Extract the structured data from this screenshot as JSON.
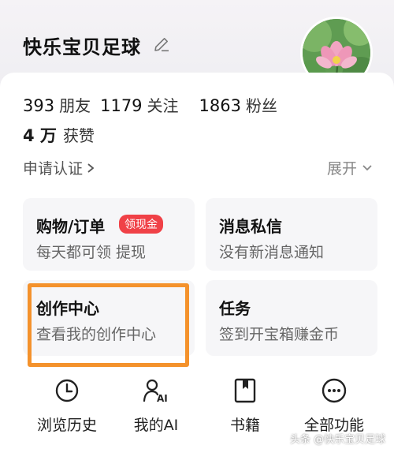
{
  "profile": {
    "username": "快乐宝贝足球"
  },
  "stats": {
    "friends_count": "393",
    "friends_label": "朋友",
    "following_count": "1179",
    "following_label": "关注",
    "followers_count": "1863",
    "followers_label": "粉丝",
    "likes_count": "4 万",
    "likes_label": "获赞"
  },
  "links": {
    "apply_verify": "申请认证",
    "expand": "展开"
  },
  "tiles": {
    "orders": {
      "title": "购物/订单",
      "badge": "领现金",
      "subtitle": "每天都可领 提现"
    },
    "messages": {
      "title": "消息私信",
      "subtitle": "没有新消息通知"
    },
    "creator": {
      "title": "创作中心",
      "subtitle": "查看我的创作中心"
    },
    "tasks": {
      "title": "任务",
      "subtitle": "签到开宝箱赚金币"
    }
  },
  "functions": [
    {
      "label": "浏览历史",
      "icon": "clock-icon"
    },
    {
      "label": "我的AI",
      "icon": "ai-person-icon"
    },
    {
      "label": "书籍",
      "icon": "book-icon"
    },
    {
      "label": "全部功能",
      "icon": "more-icon"
    }
  ],
  "watermark": "头条 @快乐宝贝足球",
  "colors": {
    "badge": "#f04147",
    "highlight": "#f4922c",
    "tile_bg": "#f6f6f8"
  }
}
